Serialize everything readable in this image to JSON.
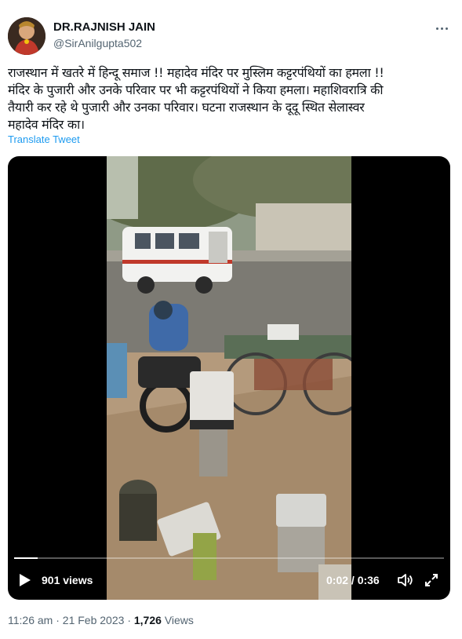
{
  "author": {
    "display_name": "DR.RAJNISH JAIN",
    "handle": "@SirAnilgupta502"
  },
  "tweet": {
    "text": "राजस्थान में खतरे में हिन्दू समाज !! महादेव मंदिर पर मुस्लिम कट्टरपंथियों का हमला !!\nमंदिर के पुजारी और उनके परिवार पर भी कट्टरपंथियों ने किया हमला। महाशिवरात्रि की\nतैयारी कर रहे थे पुजारी और उनका परिवार। घटना राजस्थान के दूदू स्थित सेलास्वर\nमहादेव मंदिर का।",
    "translate_label": "Translate Tweet"
  },
  "video": {
    "views_label": "901 views",
    "time_label": "0:02 / 0:36",
    "progress": 0.055
  },
  "meta": {
    "time": "11:26 am",
    "date": "21 Feb 2023",
    "views_count": "1,726",
    "views_word": "Views"
  },
  "icons": {
    "more": "more-icon",
    "play": "play-icon",
    "volume": "volume-icon",
    "fullscreen": "fullscreen-icon"
  },
  "colors": {
    "link": "#1d9bf0",
    "secondary_text": "#536471"
  }
}
